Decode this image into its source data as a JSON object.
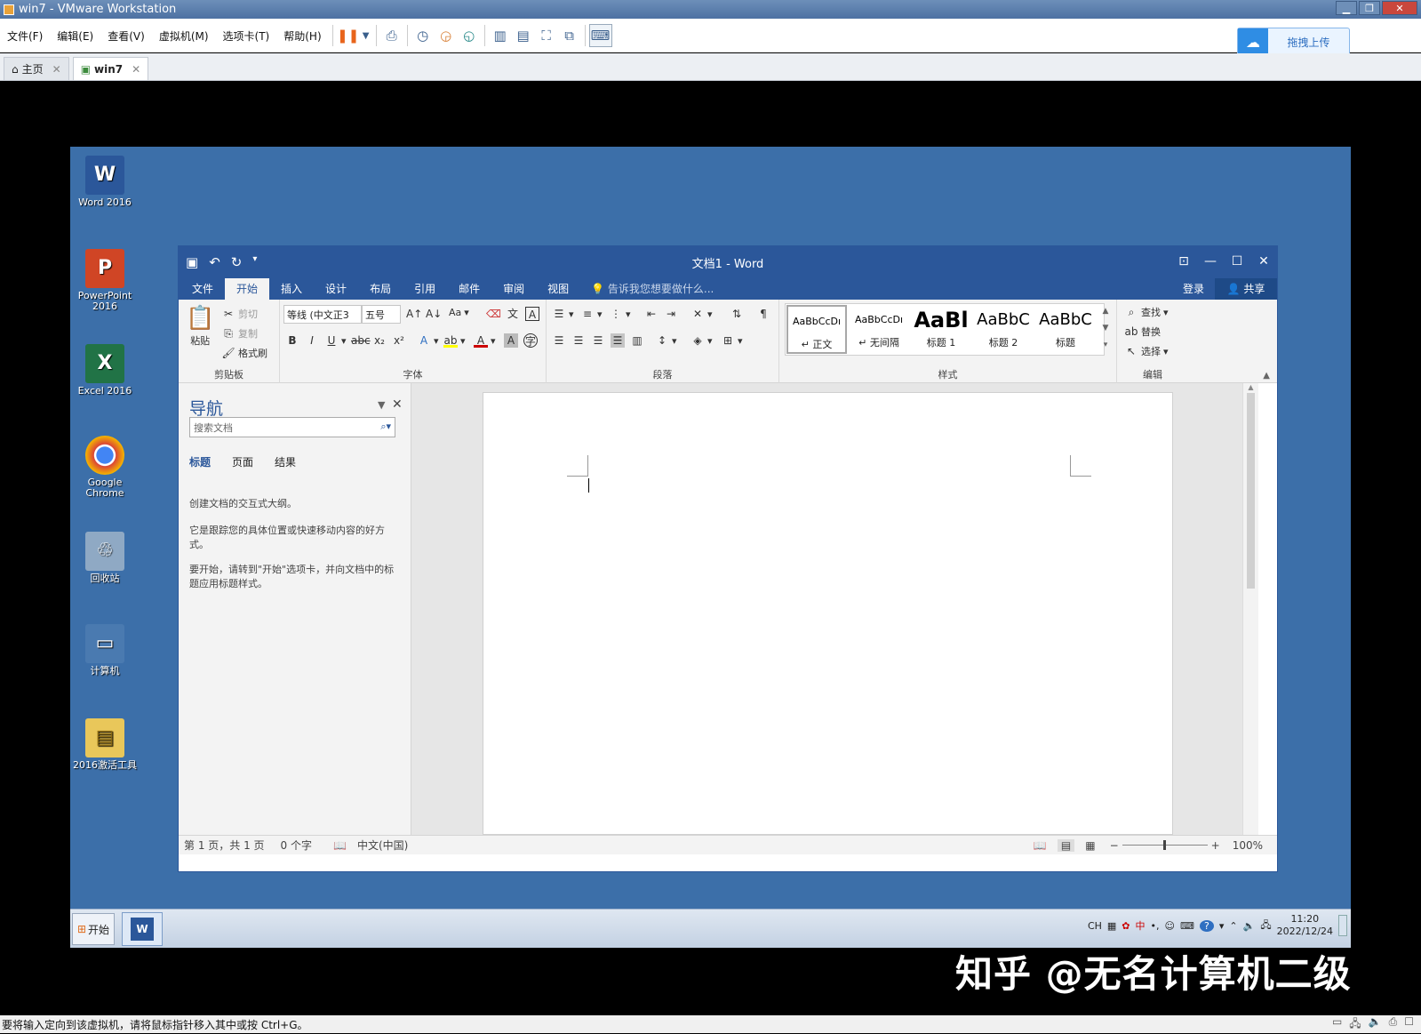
{
  "vmware": {
    "title": "win7 - VMware Workstation",
    "menus": [
      "文件(F)",
      "编辑(E)",
      "查看(V)",
      "虚拟机(M)",
      "选项卡(T)",
      "帮助(H)"
    ],
    "upload_label": "拖拽上传",
    "tabs": [
      {
        "label": "主页"
      },
      {
        "label": "win7"
      }
    ],
    "status_text": "要将输入定向到该虚拟机，请将鼠标指针移入其中或按 Ctrl+G。"
  },
  "desktop": {
    "icons": [
      {
        "label": "Word 2016",
        "icon": "word-icon",
        "color": "#2b579a",
        "glyph": "W"
      },
      {
        "label": "PowerPoint 2016",
        "icon": "powerpoint-icon",
        "color": "#d04525",
        "glyph": "P"
      },
      {
        "label": "Excel 2016",
        "icon": "excel-icon",
        "color": "#217346",
        "glyph": "X"
      },
      {
        "label": "Google Chrome",
        "icon": "chrome-icon",
        "color": "#db4437",
        "glyph": "◉"
      },
      {
        "label": "回收站",
        "icon": "recycle-bin-icon",
        "color": "#7f9bb8",
        "glyph": "♲"
      },
      {
        "label": "计算机",
        "icon": "computer-icon",
        "color": "#4a7ab0",
        "glyph": "▭"
      },
      {
        "label": "2016激活工具",
        "icon": "folder-icon",
        "color": "#e9c75a",
        "glyph": "▤"
      }
    ]
  },
  "word": {
    "title": "文档1 - Word",
    "tabs": [
      "文件",
      "开始",
      "插入",
      "设计",
      "布局",
      "引用",
      "邮件",
      "审阅",
      "视图"
    ],
    "active_tab": "开始",
    "tell_me": "告诉我您想要做什么...",
    "login": "登录",
    "share": "共享",
    "ribbon": {
      "clipboard": {
        "label": "剪贴板",
        "paste": "粘贴",
        "cut": "剪切",
        "copy": "复制",
        "format_painter": "格式刷"
      },
      "font": {
        "label": "字体",
        "font_name": "等线 (中文正3",
        "font_size": "五号",
        "change_case": "Aa"
      },
      "paragraph": {
        "label": "段落"
      },
      "styles": {
        "label": "样式",
        "items": [
          {
            "sample": "AaBbCcDı",
            "name": "↵ 正文"
          },
          {
            "sample": "AaBbCcDı",
            "name": "↵ 无间隔"
          },
          {
            "sample": "AaBl",
            "name": "标题 1"
          },
          {
            "sample": "AaBbC",
            "name": "标题 2"
          },
          {
            "sample": "AaBbC",
            "name": "标题"
          }
        ]
      },
      "editing": {
        "label": "编辑",
        "find": "查找",
        "replace": "替换",
        "select": "选择"
      }
    },
    "nav": {
      "title": "导航",
      "search_placeholder": "搜索文档",
      "tabs": [
        "标题",
        "页面",
        "结果"
      ],
      "p1": "创建文档的交互式大纲。",
      "p2": "它是跟踪您的具体位置或快速移动内容的好方式。",
      "p3": "要开始，请转到\"开始\"选项卡，并向文档中的标题应用标题样式。"
    },
    "status": {
      "page": "第 1 页，共 1 页",
      "words": "0 个字",
      "lang": "中文(中国)",
      "zoom": "100%"
    }
  },
  "taskbar": {
    "start": "开始",
    "ime": "CH",
    "ime_mode": "中",
    "time": "11:20",
    "date": "2022/12/24"
  },
  "watermark": "知乎 @无名计算机二级"
}
